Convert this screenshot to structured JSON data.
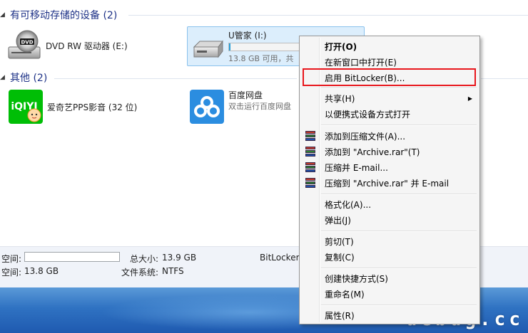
{
  "groups": {
    "removable": {
      "title": "有可移动存储的设备 (2)"
    },
    "other": {
      "title": "其他 (2)"
    }
  },
  "devices": {
    "dvd": {
      "name": "DVD RW 驱动器 (E:)",
      "icon": "dvd-drive-icon",
      "badge": "DVD"
    },
    "usb": {
      "name": "U管家 (I:)",
      "space": "13.8 GB 可用，共",
      "icon": "usb-drive-icon",
      "used_fraction": 0.02
    },
    "iqiyi": {
      "name": "爱奇艺PPS影音 (32 位)",
      "icon": "iqiyi-icon",
      "logo_text": "iQIYI"
    },
    "baidu": {
      "name": "百度网盘",
      "desc": "双击运行百度网盘",
      "icon": "baidu-netdisk-icon"
    }
  },
  "status": {
    "free_label": "空间:",
    "free_label2": "空间:",
    "free_value": "13.8 GB",
    "total_label": "总大小:",
    "total_value": "13.9 GB",
    "fs_label": "文件系统:",
    "fs_value": "NTFS",
    "bitlocker_label": "BitLocker"
  },
  "context_menu": {
    "items": [
      {
        "label": "打开(O)"
      },
      {
        "label": "在新窗口中打开(E)"
      },
      {
        "label": "启用 BitLocker(B)..."
      },
      {
        "label": "共享(H)"
      },
      {
        "label": "以便携式设备方式打开"
      },
      {
        "label": "添加到压缩文件(A)..."
      },
      {
        "label": "添加到 \"Archive.rar\"(T)"
      },
      {
        "label": "压缩并 E-mail..."
      },
      {
        "label": "压缩到 \"Archive.rar\" 并 E-mail"
      },
      {
        "label": "格式化(A)..."
      },
      {
        "label": "弹出(J)"
      },
      {
        "label": "剪切(T)"
      },
      {
        "label": "复制(C)"
      },
      {
        "label": "创建快捷方式(S)"
      },
      {
        "label": "重命名(M)"
      },
      {
        "label": "属性(R)"
      }
    ]
  },
  "watermark": "uebug.cc",
  "colors": {
    "group_header": "#1e3287",
    "selection": "#dceefc",
    "highlight_box": "#e8161c",
    "taskbar": "#2f72c2",
    "iqiyi_green": "#00be06",
    "baidu_blue": "#2b8de0"
  }
}
